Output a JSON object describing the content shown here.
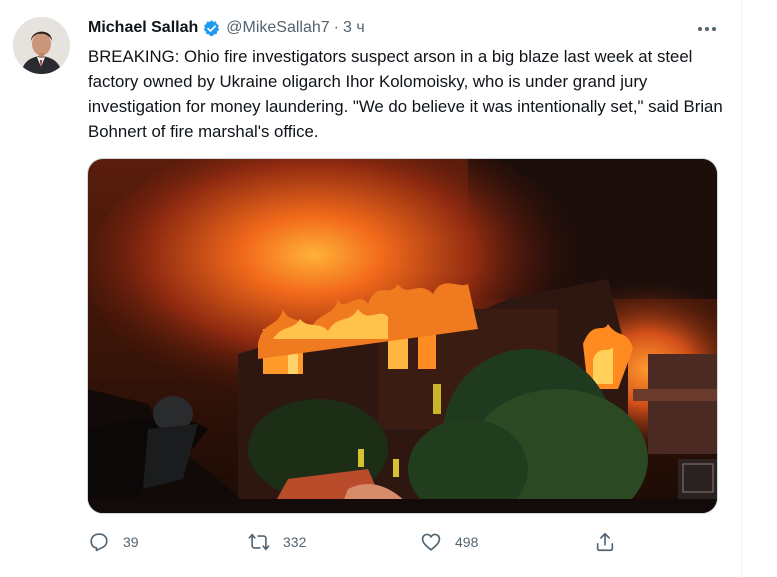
{
  "tweet": {
    "author_name": "Michael Sallah",
    "handle": "@MikeSallah7",
    "separator": "·",
    "time": "3 ч",
    "text": "BREAKING: Ohio fire investigators suspect arson in a big blaze last week at steel factory owned by Ukraine oligarch Ihor Kolomoisky, who is under grand jury investigation for money laundering. \"We do believe it was intentionally set,\" said Brian Bohnert of fire marshal's office.",
    "media_alt": "Photo of a burning steel factory at night"
  },
  "actions": {
    "reply_count": "39",
    "retweet_count": "332",
    "like_count": "498"
  },
  "icons": {
    "verified": "verified-badge-icon",
    "more": "more-options-icon",
    "reply": "reply-icon",
    "retweet": "retweet-icon",
    "like": "heart-icon",
    "share": "share-icon"
  },
  "colors": {
    "verified": "#1d9bf0",
    "secondary_text": "#536471",
    "primary_text": "#0f1419"
  }
}
